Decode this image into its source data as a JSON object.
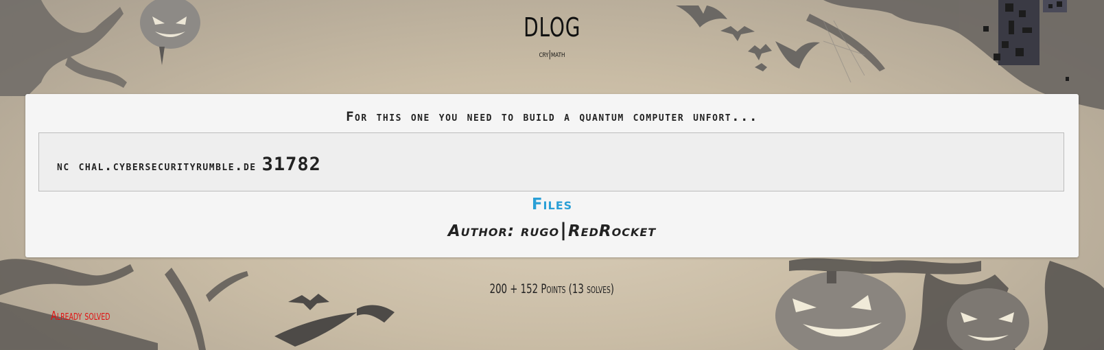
{
  "challenge": {
    "title": "DLOG",
    "category": "cry|math",
    "description": "For this one you need to build a quantum computer unfort...",
    "command": {
      "host_text": "nc chal.cybersecurityrumble.de",
      "port": "31782"
    },
    "files_label": "Files",
    "author_label": "Author:",
    "author_name_1": "rugo",
    "author_separator": "|",
    "author_name_2": "RedRocket",
    "points_text": "200 + 152 Points (13 solves)",
    "status_text": "Already solved"
  },
  "colors": {
    "card_background": "#f5f5f5",
    "link": "#2a9fd6",
    "solved": "#e01010"
  },
  "icons": [
    "pumpkin-icon",
    "bat-icon",
    "tree-icon",
    "qr-code-icon"
  ]
}
